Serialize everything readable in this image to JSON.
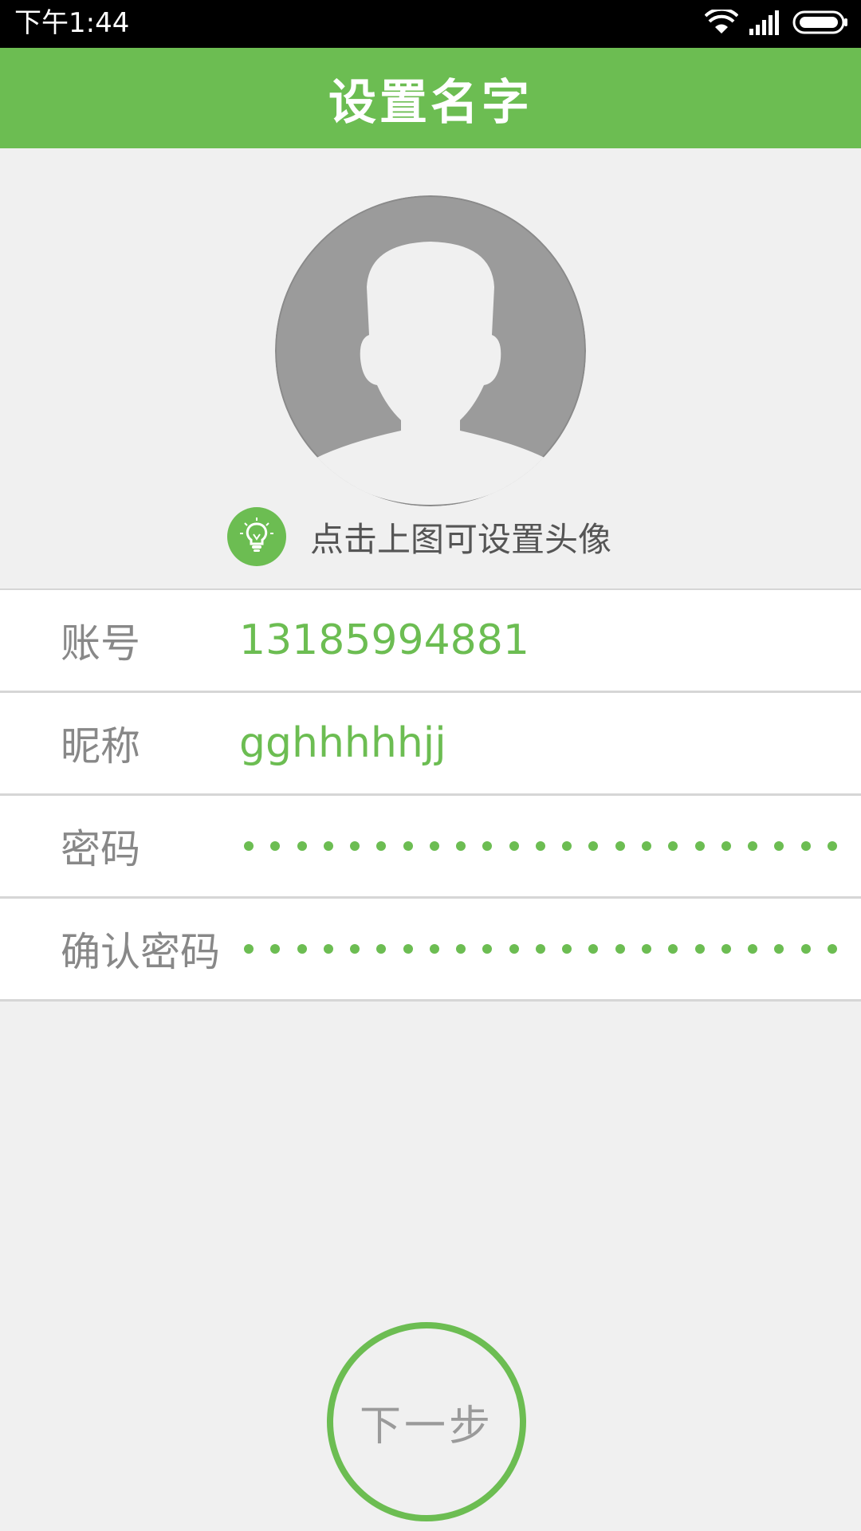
{
  "status_bar": {
    "time": "下午1:44",
    "icons": [
      "wifi-icon",
      "signal-icon",
      "battery-icon"
    ]
  },
  "header": {
    "title": "设置名字"
  },
  "avatar": {
    "icon": "default-user-avatar"
  },
  "hint": {
    "icon": "lightbulb-icon",
    "text": "点击上图可设置头像"
  },
  "form": {
    "account": {
      "label": "账号",
      "value": "13185994881"
    },
    "nickname": {
      "label": "昵称",
      "value": "gghhhhhjj"
    },
    "password": {
      "label": "密码",
      "masked_length": 23
    },
    "confirm_password": {
      "label": "确认密码",
      "masked_length": 23
    }
  },
  "next_button": {
    "label": "下一步"
  },
  "colors": {
    "accent": "#6cbd52",
    "status_bar": "#000000",
    "background": "#f0f0f0",
    "label": "#888888",
    "avatar_gray": "#9b9b9b"
  }
}
